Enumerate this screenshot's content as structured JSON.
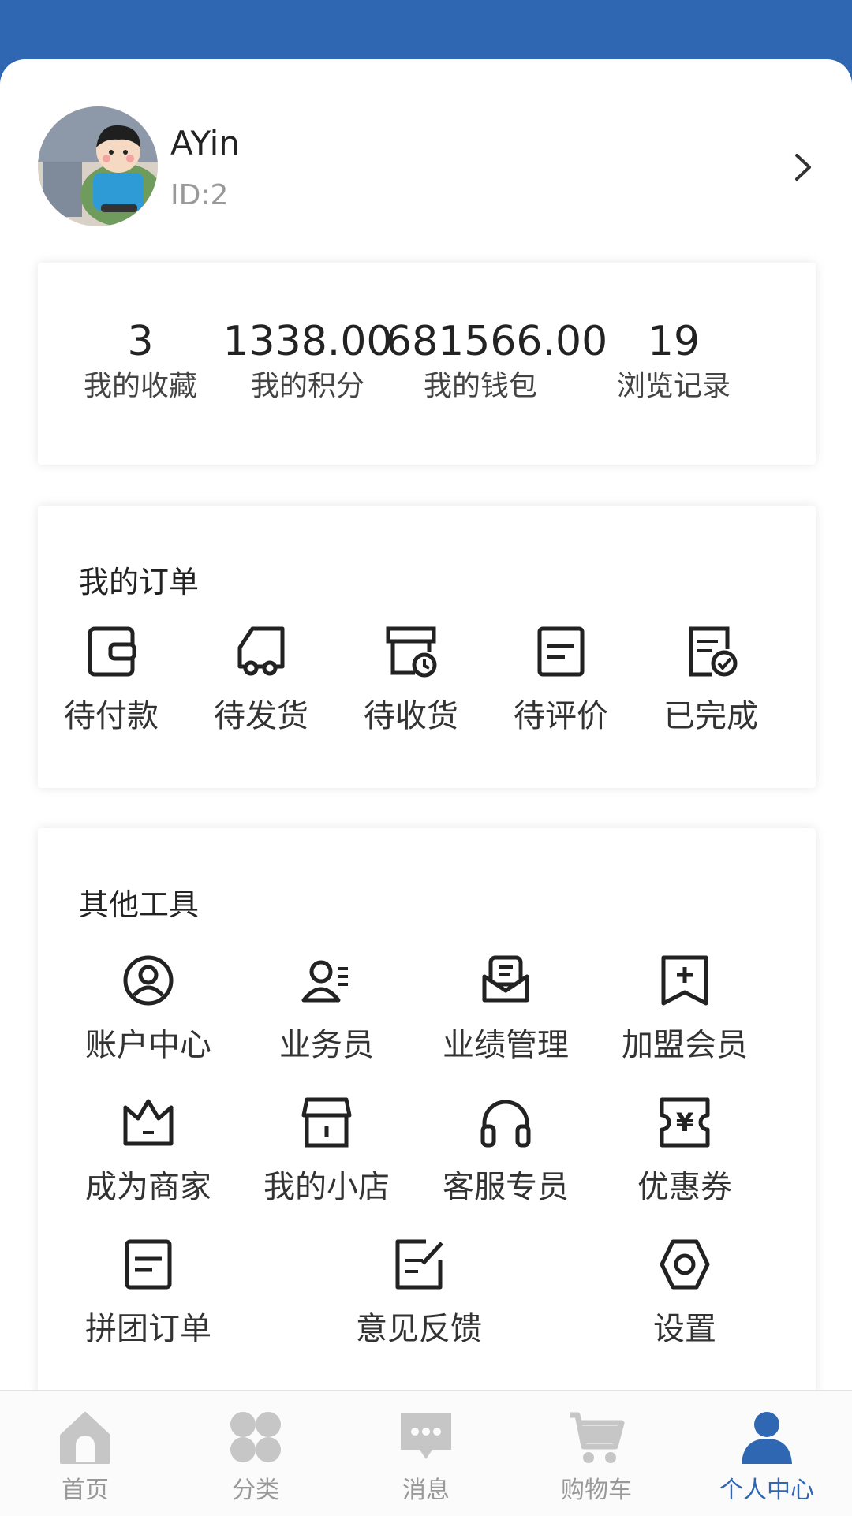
{
  "profile": {
    "username": "AYin",
    "id_text": "ID:2"
  },
  "stats": [
    {
      "value": "3",
      "label": "我的收藏"
    },
    {
      "value": "1338.00",
      "label": "我的积分"
    },
    {
      "value": "681566.00",
      "label": "我的钱包"
    },
    {
      "value": "19",
      "label": "浏览记录"
    }
  ],
  "orders": {
    "title": "我的订单",
    "items": [
      {
        "label": "待付款",
        "icon": "wallet-icon"
      },
      {
        "label": "待发货",
        "icon": "truck-icon"
      },
      {
        "label": "待收货",
        "icon": "box-clock-icon"
      },
      {
        "label": "待评价",
        "icon": "note-icon"
      },
      {
        "label": "已完成",
        "icon": "doc-check-icon"
      }
    ]
  },
  "tools": {
    "title": "其他工具",
    "items": [
      {
        "label": "账户中心",
        "icon": "user-circle-icon"
      },
      {
        "label": "业务员",
        "icon": "salesman-icon"
      },
      {
        "label": "业绩管理",
        "icon": "mail-open-icon"
      },
      {
        "label": "加盟会员",
        "icon": "bookmark-plus-icon"
      },
      {
        "label": "成为商家",
        "icon": "crown-icon"
      },
      {
        "label": "我的小店",
        "icon": "shop-icon"
      },
      {
        "label": "客服专员",
        "icon": "headphones-icon"
      },
      {
        "label": "优惠券",
        "icon": "coupon-icon"
      },
      {
        "label": "拼团订单",
        "icon": "note-icon"
      },
      {
        "label": "意见反馈",
        "icon": "edit-note-icon"
      },
      {
        "label": "设置",
        "icon": "settings-hex-icon"
      }
    ]
  },
  "tabbar": {
    "items": [
      {
        "label": "首页",
        "icon": "home-icon"
      },
      {
        "label": "分类",
        "icon": "category-icon"
      },
      {
        "label": "消息",
        "icon": "message-icon"
      },
      {
        "label": "购物车",
        "icon": "cart-icon"
      },
      {
        "label": "个人中心",
        "icon": "person-icon"
      }
    ],
    "active_index": 4
  },
  "colors": {
    "brand": "#2f67b3",
    "inactive_tab": "#bdbdbd"
  }
}
